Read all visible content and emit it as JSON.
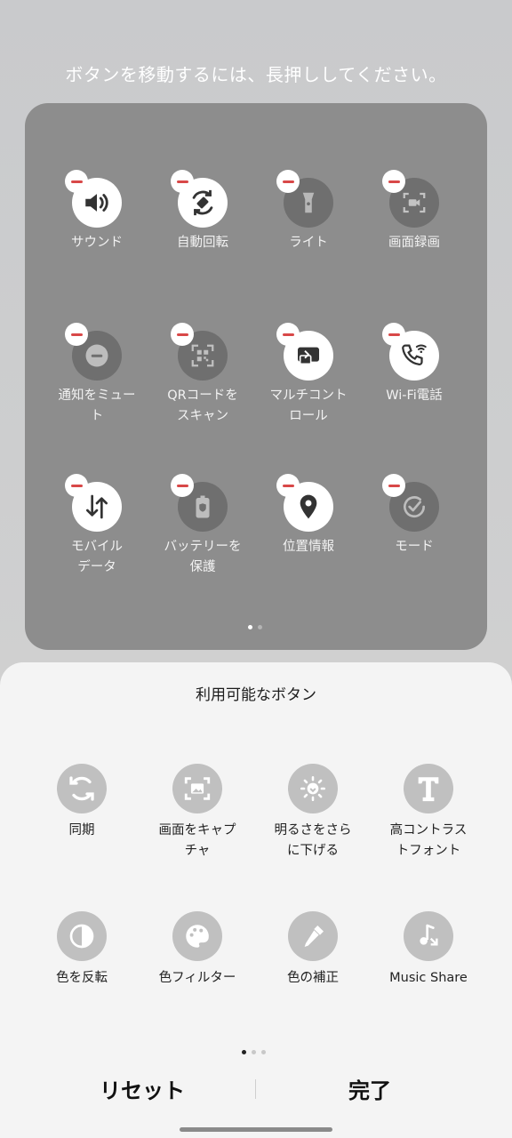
{
  "hint": "ボタンを移動するには、長押ししてください。",
  "active_tiles": [
    {
      "label": "サウンド",
      "icon": "speaker-icon",
      "on": true
    },
    {
      "label": "自動回転",
      "icon": "rotate-icon",
      "on": true
    },
    {
      "label": "ライト",
      "icon": "flashlight-icon",
      "on": false
    },
    {
      "label": "画面録画",
      "icon": "screen-record-icon",
      "on": false
    },
    {
      "label": "通知をミュー\nト",
      "icon": "mute-icon",
      "on": false
    },
    {
      "label": "QRコードを\nスキャン",
      "icon": "qr-scan-icon",
      "on": false
    },
    {
      "label": "マルチコント\nロール",
      "icon": "multi-control-icon",
      "on": true
    },
    {
      "label": "Wi-Fi電話",
      "icon": "wifi-call-icon",
      "on": true
    },
    {
      "label": "モバイル\nデータ",
      "icon": "mobile-data-icon",
      "on": true
    },
    {
      "label": "バッテリーを\n保護",
      "icon": "battery-protect-icon",
      "on": false
    },
    {
      "label": "位置情報",
      "icon": "location-icon",
      "on": true
    },
    {
      "label": "モード",
      "icon": "mode-icon",
      "on": false
    }
  ],
  "sheet": {
    "title": "利用可能なボタン",
    "items": [
      {
        "label": "同期",
        "icon": "sync-icon"
      },
      {
        "label": "画面をキャプ\nチャ",
        "icon": "capture-icon"
      },
      {
        "label": "明るさをさら\nに下げる",
        "icon": "extra-dim-icon"
      },
      {
        "label": "高コントラス\nトフォント",
        "icon": "high-contrast-font-icon"
      },
      {
        "label": "色を反転",
        "icon": "invert-colors-icon"
      },
      {
        "label": "色フィルター",
        "icon": "color-filter-icon"
      },
      {
        "label": "色の補正",
        "icon": "color-correction-icon"
      },
      {
        "label": "Music Share",
        "icon": "music-share-icon"
      }
    ],
    "reset": "リセット",
    "done": "完了"
  },
  "colors": {
    "remove_badge": "#d84848",
    "panel": "#8d8d8d",
    "sheet": "#f4f4f4"
  }
}
